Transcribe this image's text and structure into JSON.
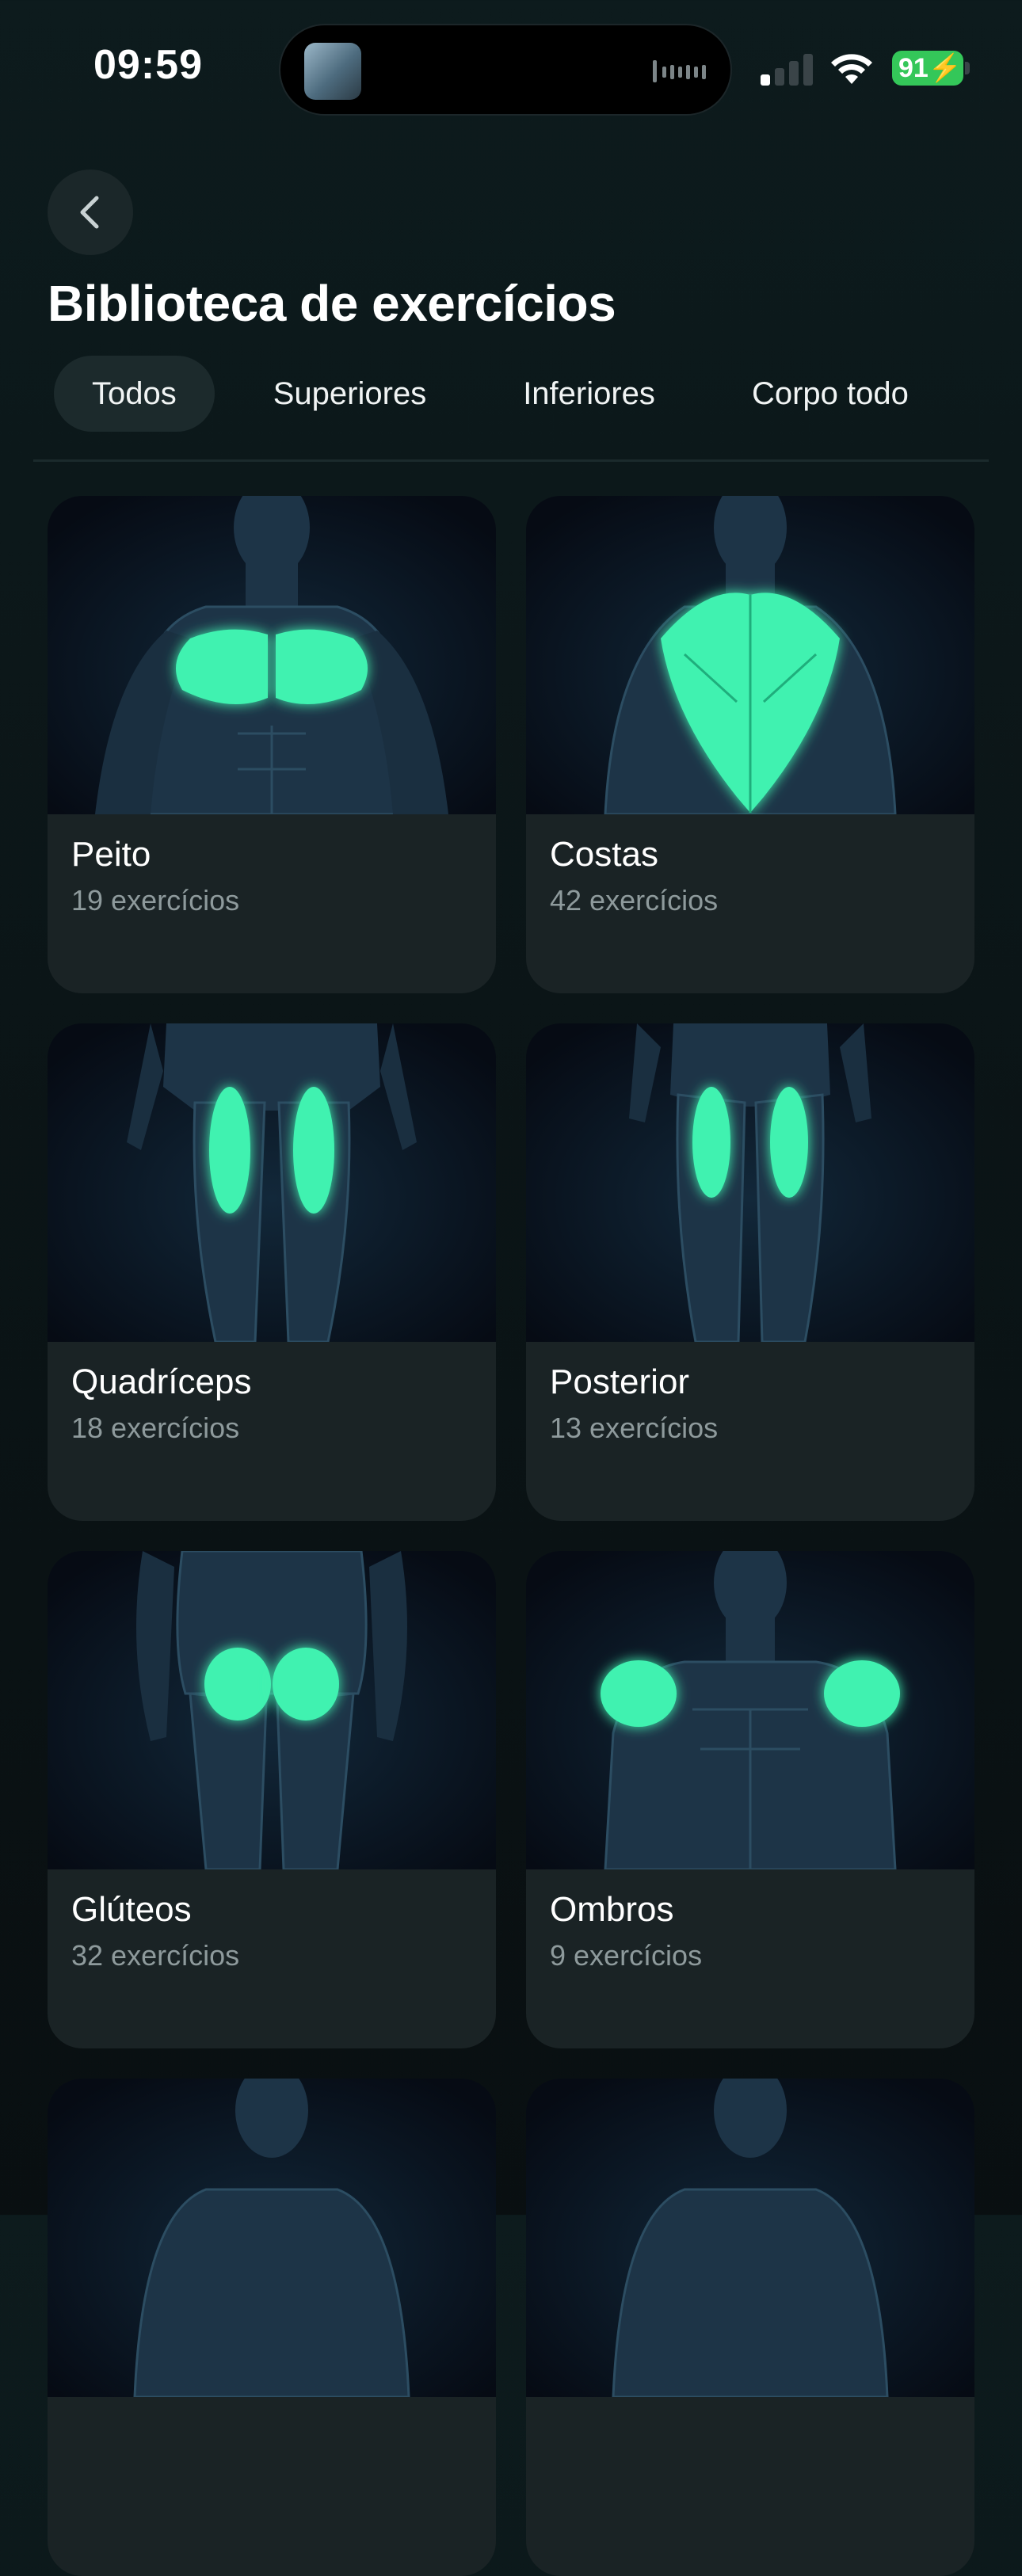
{
  "status_bar": {
    "time": "09:59",
    "battery": "91"
  },
  "header": {
    "title": "Biblioteca de exercícios"
  },
  "tabs": [
    {
      "label": "Todos",
      "active": true
    },
    {
      "label": "Superiores",
      "active": false
    },
    {
      "label": "Inferiores",
      "active": false
    },
    {
      "label": "Corpo todo",
      "active": false
    }
  ],
  "accent_color": "#3ff2b0",
  "cards": [
    {
      "name": "Peito",
      "count": "19 exercícios",
      "muscle": "chest"
    },
    {
      "name": "Costas",
      "count": "42 exercícios",
      "muscle": "back"
    },
    {
      "name": "Quadríceps",
      "count": "18 exercícios",
      "muscle": "quads"
    },
    {
      "name": "Posterior",
      "count": "13 exercícios",
      "muscle": "hamstrings"
    },
    {
      "name": "Glúteos",
      "count": "32 exercícios",
      "muscle": "glutes"
    },
    {
      "name": "Ombros",
      "count": "9 exercícios",
      "muscle": "shoulders"
    },
    {
      "name": "",
      "count": "",
      "muscle": "upper"
    },
    {
      "name": "",
      "count": "",
      "muscle": "upper"
    }
  ]
}
